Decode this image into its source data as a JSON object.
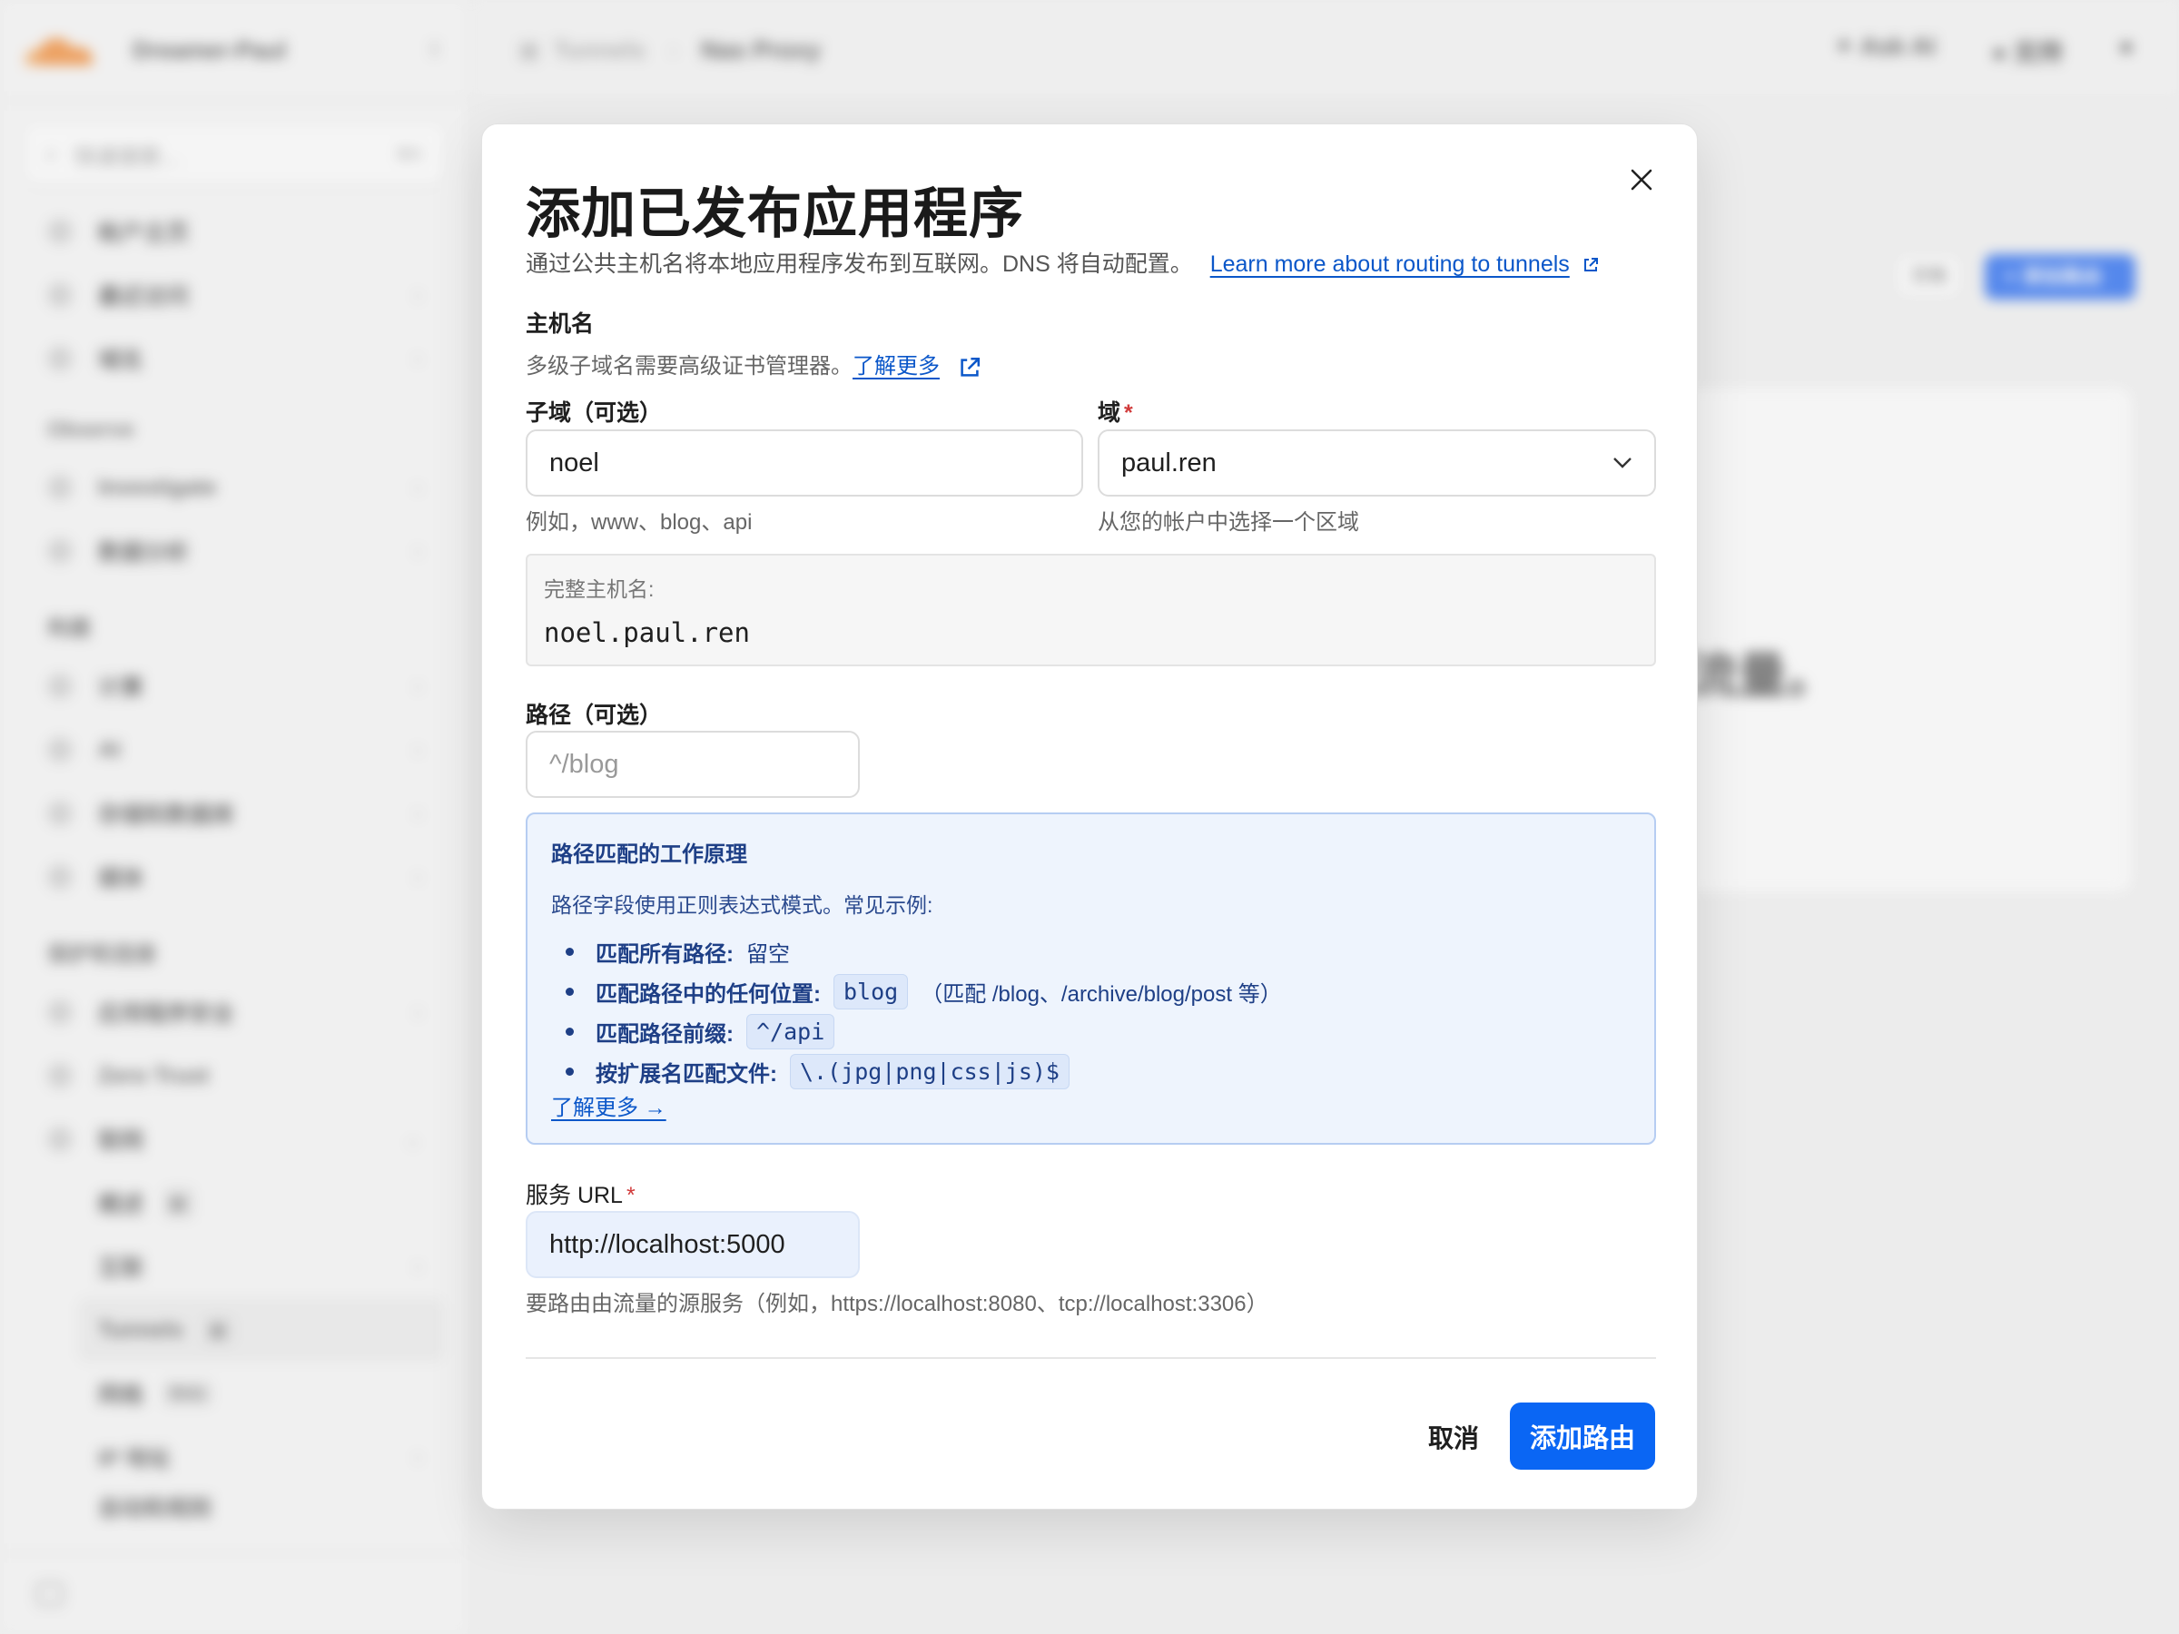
{
  "app": {
    "account_name": "Dreamer-Paul",
    "search_placeholder": "快速搜索...",
    "search_shortcut": "⌘K",
    "sidebar": [
      {
        "label": "帐户主页",
        "chevron": false
      },
      {
        "label": "最近访问",
        "chevron": true
      },
      {
        "label": "域名",
        "chevron": true
      }
    ],
    "section_observe": "Observe",
    "observe_items": [
      {
        "label": "Investigate"
      },
      {
        "label": "数据分析"
      }
    ],
    "section_build": "构建",
    "build_items": [
      {
        "label": "计算"
      },
      {
        "label": "AI"
      },
      {
        "label": "存储和数据库"
      },
      {
        "label": "媒体"
      }
    ],
    "section_protect": "保护和连接",
    "protect_items": [
      {
        "label": "应用程序安全"
      },
      {
        "label": "Zero Trust"
      },
      {
        "label": "联网"
      }
    ],
    "network_sub": [
      {
        "label": "概述",
        "badge": "新"
      },
      {
        "label": "互联",
        "badge": ""
      },
      {
        "label": "Tunnels",
        "badge": "新"
      },
      {
        "label": "网格",
        "badge": "Beta"
      },
      {
        "label": "IP 地址",
        "badge": ""
      },
      {
        "label": "自动和规则",
        "badge": ""
      }
    ],
    "breadcrumb": {
      "root": "Tunnels",
      "current": "Nas Proxy"
    },
    "topbar": {
      "ask_ai": "Ask AI",
      "support": "支持"
    },
    "bg_doc_button": "文档",
    "bg_add_button": "添加路由",
    "bg_text": "流量。"
  },
  "modal": {
    "title": "添加已发布应用程序",
    "subtitle": "通过公共主机名将本地应用程序发布到互联网。DNS 将自动配置。",
    "subtitle_link": "Learn more about routing to tunnels",
    "hostname_label": "主机名",
    "hostname_hint": "多级子域名需要高级证书管理器。",
    "hostname_hint_link": "了解更多",
    "subdomain_label": "子域（可选）",
    "subdomain_value": "noel",
    "subdomain_hint": "例如，www、blog、api",
    "domain_label": "域",
    "domain_value": "paul.ren",
    "domain_hint": "从您的帐户中选择一个区域",
    "fullhost_label": "完整主机名:",
    "fullhost_value": "noel.paul.ren",
    "path_label": "路径（可选）",
    "path_placeholder": "^/blog",
    "info": {
      "title": "路径匹配的工作原理",
      "desc": "路径字段使用正则表达式模式。常见示例:",
      "items": [
        {
          "label": "匹配所有路径:",
          "plain": "留空",
          "code": "",
          "note": ""
        },
        {
          "label": "匹配路径中的任何位置:",
          "plain": "",
          "code": "blog",
          "note": "（匹配 /blog、/archive/blog/post 等）"
        },
        {
          "label": "匹配路径前缀:",
          "plain": "",
          "code": "^/api",
          "note": ""
        },
        {
          "label": "按扩展名匹配文件:",
          "plain": "",
          "code": "\\.(jpg|png|css|js)$",
          "note": ""
        }
      ],
      "more_link": "了解更多 →"
    },
    "service_label": "服务 URL",
    "service_value": "http://localhost:5000",
    "service_hint": "要路由由流量的源服务（例如，https://localhost:8080、tcp://localhost:3306）",
    "cancel_label": "取消",
    "submit_label": "添加路由",
    "colors": {
      "primary": "#0a66f4",
      "link": "#0b57c9",
      "info_bg": "#eef4fd",
      "info_border": "#b6cdf2",
      "required": "#d13b3b"
    }
  }
}
